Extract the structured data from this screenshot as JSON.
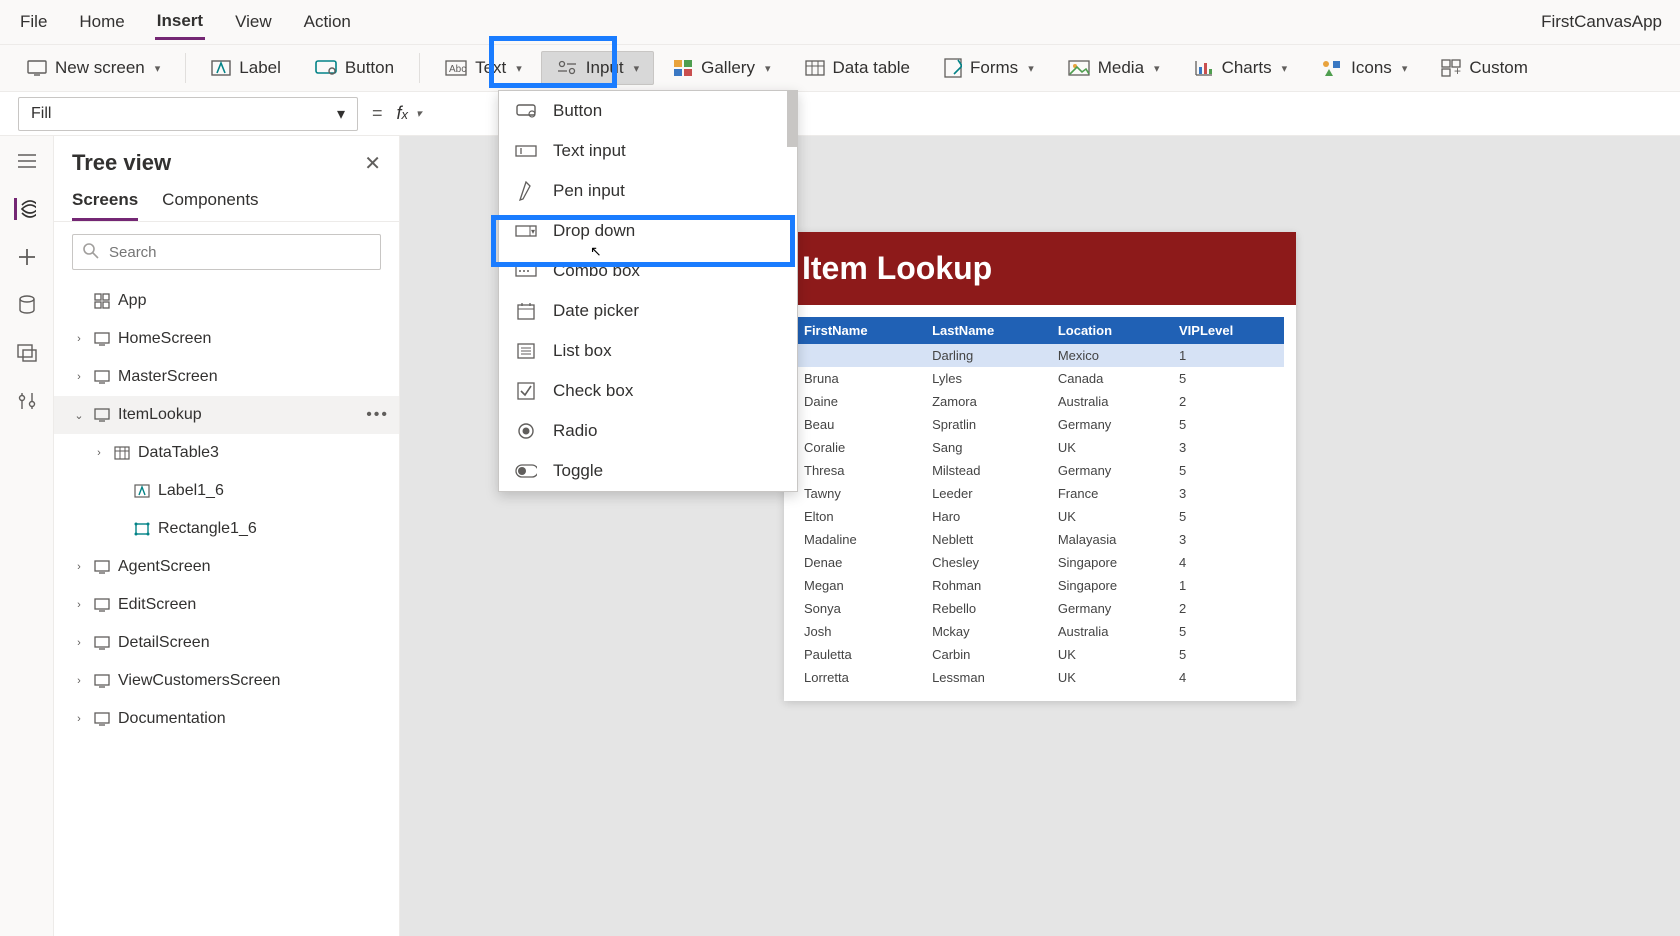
{
  "app_title": "FirstCanvasApp",
  "menu": {
    "file": "File",
    "home": "Home",
    "insert": "Insert",
    "view": "View",
    "action": "Action"
  },
  "ribbon": {
    "new_screen": "New screen",
    "label": "Label",
    "button": "Button",
    "text": "Text",
    "input": "Input",
    "gallery": "Gallery",
    "data_table": "Data table",
    "forms": "Forms",
    "media": "Media",
    "charts": "Charts",
    "icons": "Icons",
    "custom": "Custom"
  },
  "formula": {
    "property": "Fill",
    "value": ""
  },
  "tree": {
    "title": "Tree view",
    "tabs": {
      "screens": "Screens",
      "components": "Components"
    },
    "search_placeholder": "Search",
    "app": "App",
    "items": [
      {
        "label": "HomeScreen"
      },
      {
        "label": "MasterScreen"
      },
      {
        "label": "ItemLookup",
        "selected": true,
        "expanded": true,
        "children": [
          {
            "label": "DataTable3",
            "kind": "table",
            "expanded_arrow": true
          },
          {
            "label": "Label1_6",
            "kind": "label"
          },
          {
            "label": "Rectangle1_6",
            "kind": "rect"
          }
        ]
      },
      {
        "label": "AgentScreen"
      },
      {
        "label": "EditScreen"
      },
      {
        "label": "DetailScreen"
      },
      {
        "label": "ViewCustomersScreen"
      },
      {
        "label": "Documentation"
      }
    ]
  },
  "dropdown": {
    "items": [
      "Button",
      "Text input",
      "Pen input",
      "Drop down",
      "Combo box",
      "Date picker",
      "List box",
      "Check box",
      "Radio",
      "Toggle"
    ]
  },
  "canvas": {
    "title": "Item Lookup",
    "headers": [
      "FirstName",
      "LastName",
      "Location",
      "VIPLevel"
    ],
    "rows": [
      [
        "",
        "Darling",
        "Mexico",
        "1"
      ],
      [
        "Bruna",
        "Lyles",
        "Canada",
        "5"
      ],
      [
        "Daine",
        "Zamora",
        "Australia",
        "2"
      ],
      [
        "Beau",
        "Spratlin",
        "Germany",
        "5"
      ],
      [
        "Coralie",
        "Sang",
        "UK",
        "3"
      ],
      [
        "Thresa",
        "Milstead",
        "Germany",
        "5"
      ],
      [
        "Tawny",
        "Leeder",
        "France",
        "3"
      ],
      [
        "Elton",
        "Haro",
        "UK",
        "5"
      ],
      [
        "Madaline",
        "Neblett",
        "Malayasia",
        "3"
      ],
      [
        "Denae",
        "Chesley",
        "Singapore",
        "4"
      ],
      [
        "Megan",
        "Rohman",
        "Singapore",
        "1"
      ],
      [
        "Sonya",
        "Rebello",
        "Germany",
        "2"
      ],
      [
        "Josh",
        "Mckay",
        "Australia",
        "5"
      ],
      [
        "Pauletta",
        "Carbin",
        "UK",
        "5"
      ],
      [
        "Lorretta",
        "Lessman",
        "UK",
        "4"
      ]
    ]
  }
}
